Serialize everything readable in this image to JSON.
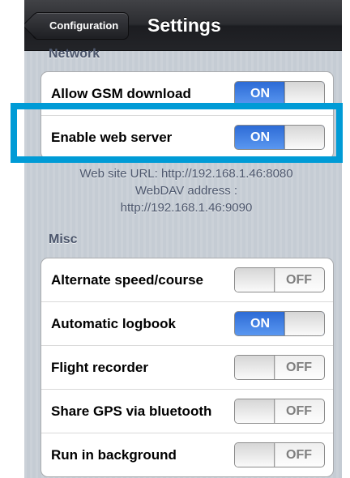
{
  "navbar": {
    "back_label": "Configuration",
    "title": "Settings"
  },
  "sections": {
    "network": {
      "header": "Network",
      "rows": [
        {
          "label": "Allow GSM download",
          "switch": "ON"
        },
        {
          "label": "Enable web server",
          "switch": "ON"
        }
      ],
      "footer": [
        "Web site URL: http://192.168.1.46:8080",
        "WebDAV address :",
        "http://192.168.1.46:9090"
      ]
    },
    "misc": {
      "header": "Misc",
      "rows": [
        {
          "label": "Alternate speed/course",
          "switch": "OFF"
        },
        {
          "label": "Automatic logbook",
          "switch": "ON"
        },
        {
          "label": "Flight recorder",
          "switch": "OFF"
        },
        {
          "label": "Share GPS via bluetooth",
          "switch": "OFF"
        },
        {
          "label": "Run in background",
          "switch": "OFF"
        }
      ]
    }
  },
  "colors": {
    "highlight": "#009bd6",
    "switch_on": "#3a7ee4",
    "background": "#c5ccd4"
  }
}
